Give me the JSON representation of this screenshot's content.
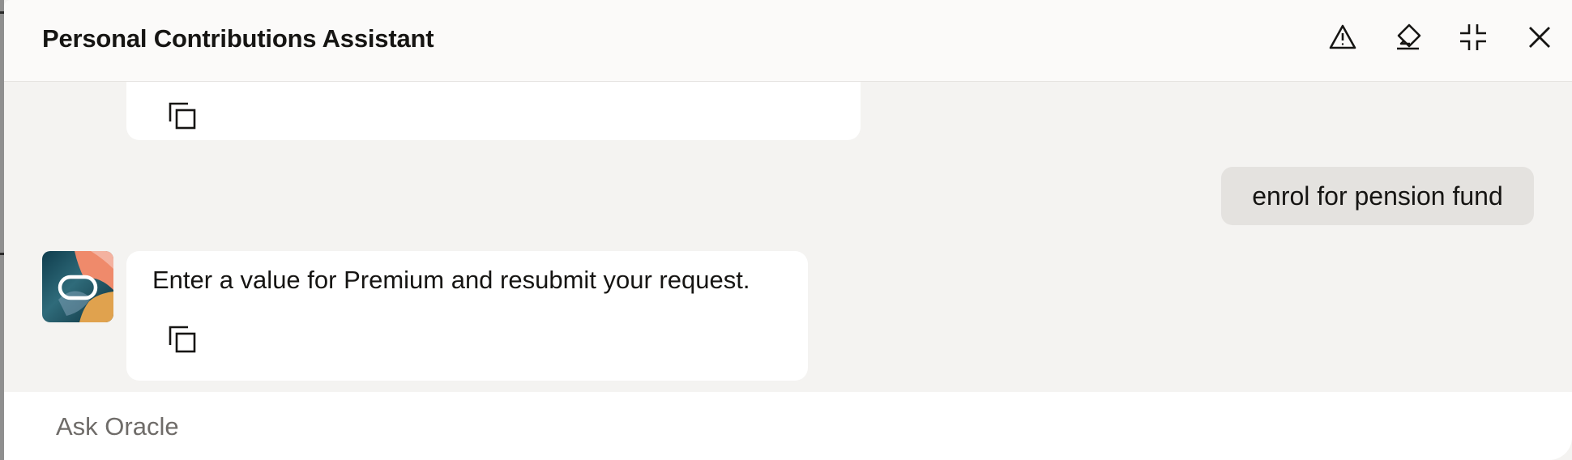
{
  "header": {
    "title": "Personal Contributions Assistant",
    "icons": [
      "warning-icon",
      "eraser-icon",
      "minimize-icon",
      "close-icon"
    ]
  },
  "messages": [
    {
      "role": "bot",
      "text": "",
      "partial": true,
      "actions": [
        "copy-icon"
      ]
    },
    {
      "role": "user",
      "text": "enrol for pension fund"
    },
    {
      "role": "bot",
      "text": "Enter a value for Premium and resubmit your request.",
      "actions": [
        "copy-icon"
      ]
    }
  ],
  "composer": {
    "placeholder": "Ask Oracle",
    "value": ""
  },
  "colors": {
    "background": "#f4f3f1",
    "header": "#fbfaf9",
    "bot_bubble": "#ffffff",
    "user_bubble": "#e4e2df",
    "text": "#161513"
  }
}
